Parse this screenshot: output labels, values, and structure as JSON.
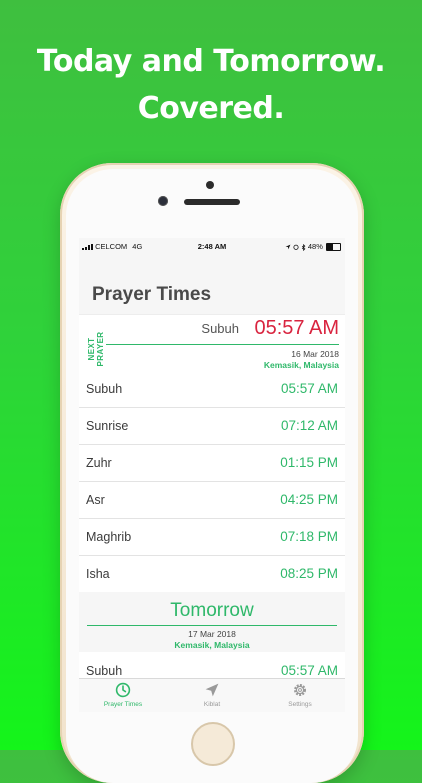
{
  "headline": {
    "line1": "Today and Tomorrow.",
    "line2": "Covered."
  },
  "status_bar": {
    "carrier": "CELCOM",
    "network": "4G",
    "time": "2:48 AM",
    "battery": "48%"
  },
  "page_title": "Prayer Times",
  "next_prayer": {
    "label": "NEXT PRAYER",
    "name": "Subuh",
    "time": "05:57 AM",
    "date": "16 Mar 2018",
    "location": "Kemasik, Malaysia"
  },
  "today": [
    {
      "name": "Subuh",
      "time": "05:57 AM"
    },
    {
      "name": "Sunrise",
      "time": "07:12 AM"
    },
    {
      "name": "Zuhr",
      "time": "01:15 PM"
    },
    {
      "name": "Asr",
      "time": "04:25 PM"
    },
    {
      "name": "Maghrib",
      "time": "07:18 PM"
    },
    {
      "name": "Isha",
      "time": "08:25 PM"
    }
  ],
  "tomorrow": {
    "title": "Tomorrow",
    "date": "17 Mar 2018",
    "location": "Kemasik, Malaysia",
    "first": {
      "name": "Subuh",
      "time": "05:57 AM"
    }
  },
  "tabs": [
    {
      "label": "Prayer Times",
      "icon": "clock-icon",
      "active": true
    },
    {
      "label": "Kiblat",
      "icon": "location-arrow-icon",
      "active": false
    },
    {
      "label": "Settings",
      "icon": "gear-icon",
      "active": false
    }
  ],
  "colors": {
    "accent": "#2fb86a",
    "next_time": "#d9243f",
    "inactive_tab": "#9a9a9a"
  }
}
